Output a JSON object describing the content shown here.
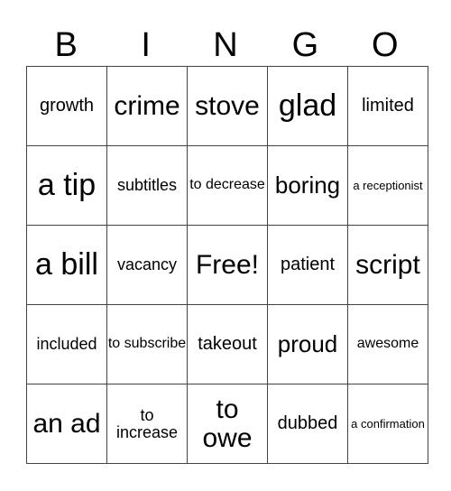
{
  "header": [
    "B",
    "I",
    "N",
    "G",
    "O"
  ],
  "cells": [
    [
      "growth",
      "crime",
      "stove",
      "glad",
      "limited"
    ],
    [
      "a tip",
      "subtitles",
      "to decrease",
      "boring",
      "a receptionist"
    ],
    [
      "a bill",
      "vacancy",
      "Free!",
      "patient",
      "script"
    ],
    [
      "included",
      "to subscribe",
      "takeout",
      "proud",
      "awesome"
    ],
    [
      "an ad",
      "to increase",
      "to owe",
      "dubbed",
      "a confirmation"
    ]
  ],
  "free_space": "Free!"
}
